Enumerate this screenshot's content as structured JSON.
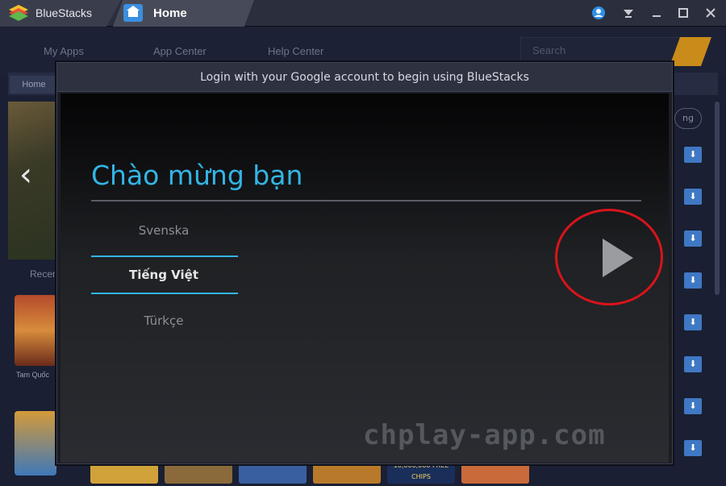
{
  "titlebar": {
    "app_name": "BlueStacks",
    "active_tab": "Home"
  },
  "nav": {
    "my_apps": "My Apps",
    "app_center": "App Center",
    "help_center": "Help Center",
    "search_placeholder": "Search"
  },
  "subnav": {
    "home": "Home"
  },
  "background": {
    "recent_label": "Recen",
    "thumb1_label": "Tam Quốc",
    "bottom_badge": "10,000,000 FREE CHIPS"
  },
  "dialog": {
    "title": "Login with your Google account to begin using BlueStacks",
    "welcome": "Chào mừng bạn",
    "languages": [
      {
        "label": "Svenska",
        "selected": false
      },
      {
        "label": "Tiếng Việt",
        "selected": true
      },
      {
        "label": "Türkçe",
        "selected": false
      }
    ]
  },
  "watermark": "chplay-app.com",
  "colors": {
    "accent_cyan": "#33b5e5",
    "highlight_circle": "#d8141b",
    "search_button": "#c98b1a"
  }
}
